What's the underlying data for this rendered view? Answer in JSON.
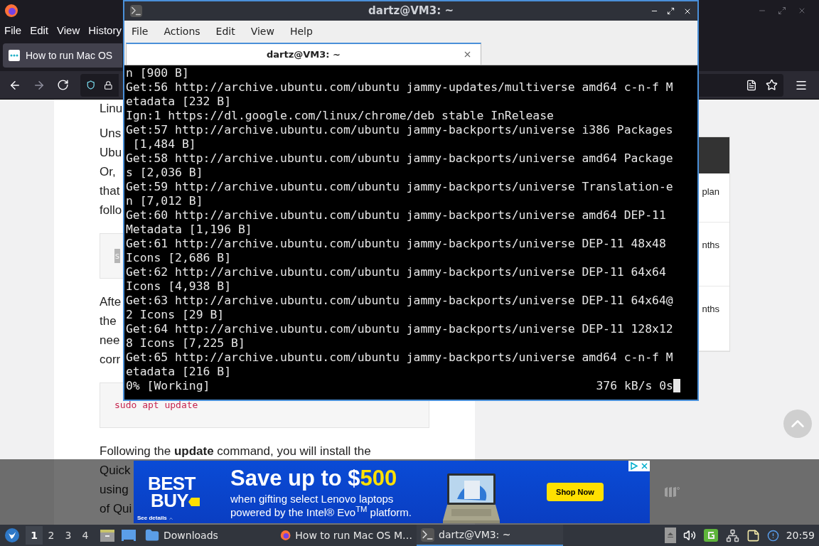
{
  "browser": {
    "menu": [
      "File",
      "Edit",
      "View",
      "History"
    ],
    "tab": {
      "title": "How to run Mac OS",
      "selected": true
    },
    "article": [
      {
        "kind": "paragraph",
        "lines": [
          "Linu"
        ]
      },
      {
        "kind": "paragraph",
        "lines": [
          "Uns",
          "Ubu",
          "Or,",
          "that",
          "follo"
        ]
      },
      {
        "kind": "code",
        "text": "s",
        "highlighted": true
      },
      {
        "kind": "paragraph",
        "lines": [
          "Afte",
          "the",
          "nee",
          "corr"
        ]
      },
      {
        "kind": "code",
        "text": "sudo apt update",
        "highlighted": false
      },
      {
        "kind": "paragraph",
        "lines": [
          "Following the **update** command, you will install the",
          "Quick",
          "using",
          "of Qui"
        ]
      }
    ],
    "side_card": {
      "rows": [
        "plan",
        "nths",
        "nths"
      ]
    }
  },
  "ad": {
    "logo": [
      "BEST",
      "BUY"
    ],
    "see_details": "See details",
    "headline": "Save up to $",
    "headline_highlight": "500",
    "lines": [
      "when gifting select Lenovo laptops",
      "powered by the Intel® Evo$^{TM}$ platform."
    ],
    "button": "Shop Now"
  },
  "terminal": {
    "title": "dartz@VM3: ~",
    "menu": [
      "File",
      "Actions",
      "Edit",
      "View",
      "Help"
    ],
    "tabs": [
      {
        "title": "dartz@VM3: ~",
        "selected": true
      }
    ],
    "lines": [
      "n [900 B]",
      "Get:56 http://archive.ubuntu.com/ubuntu jammy-updates/multiverse amd64 c-n-f M",
      "etadata [232 B]",
      "Ign:1 https://dl.google.com/linux/chrome/deb stable InRelease",
      "Get:57 http://archive.ubuntu.com/ubuntu jammy-backports/universe i386 Packages",
      " [1,484 B]",
      "Get:58 http://archive.ubuntu.com/ubuntu jammy-backports/universe amd64 Package",
      "s [2,036 B]",
      "Get:59 http://archive.ubuntu.com/ubuntu jammy-backports/universe Translation-e",
      "n [7,012 B]",
      "Get:60 http://archive.ubuntu.com/ubuntu jammy-backports/universe amd64 DEP-11",
      "Metadata [1,196 B]",
      "Get:61 http://archive.ubuntu.com/ubuntu jammy-backports/universe DEP-11 48x48",
      "Icons [2,686 B]",
      "Get:62 http://archive.ubuntu.com/ubuntu jammy-backports/universe DEP-11 64x64",
      "Icons [4,938 B]",
      "Get:63 http://archive.ubuntu.com/ubuntu jammy-backports/universe DEP-11 64x64@",
      "2 Icons [29 B]",
      "Get:64 http://archive.ubuntu.com/ubuntu jammy-backports/universe DEP-11 128x12",
      "8 Icons [7,225 B]",
      "Get:65 http://archive.ubuntu.com/ubuntu jammy-backports/universe amd64 c-n-f M",
      "etadata [216 B]"
    ],
    "status": {
      "left": "0% [Working]",
      "right": "376 kB/s 0s"
    }
  },
  "taskbar": {
    "workspaces": [
      {
        "label": "1",
        "selected": true
      },
      {
        "label": "2",
        "selected": false
      },
      {
        "label": "3",
        "selected": false
      },
      {
        "label": "4",
        "selected": false
      }
    ],
    "tasks": [
      {
        "kind": "folder",
        "label": "Downloads",
        "selected": false
      },
      {
        "kind": "browser",
        "label": "How to run Mac OS M…",
        "selected": false
      },
      {
        "kind": "terminal",
        "label": "dartz@VM3: ~",
        "selected": true
      }
    ],
    "clock": "20:59"
  }
}
